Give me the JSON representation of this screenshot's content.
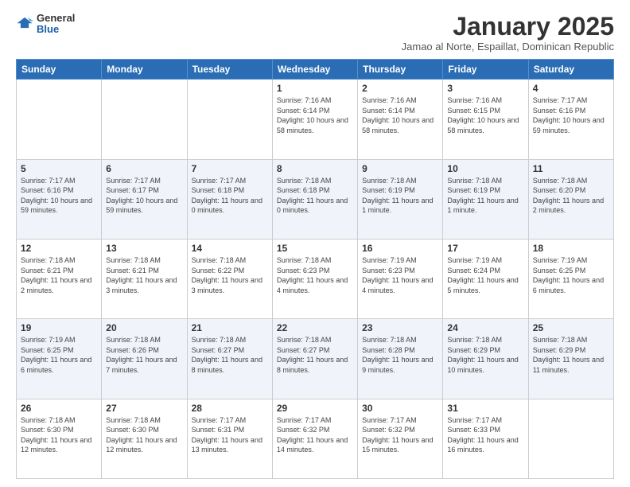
{
  "header": {
    "logo": {
      "general": "General",
      "blue": "Blue"
    },
    "title": "January 2025",
    "subtitle": "Jamao al Norte, Espaillat, Dominican Republic"
  },
  "days_of_week": [
    "Sunday",
    "Monday",
    "Tuesday",
    "Wednesday",
    "Thursday",
    "Friday",
    "Saturday"
  ],
  "weeks": [
    [
      {
        "day": "",
        "info": ""
      },
      {
        "day": "",
        "info": ""
      },
      {
        "day": "",
        "info": ""
      },
      {
        "day": "1",
        "info": "Sunrise: 7:16 AM\nSunset: 6:14 PM\nDaylight: 10 hours and 58 minutes."
      },
      {
        "day": "2",
        "info": "Sunrise: 7:16 AM\nSunset: 6:14 PM\nDaylight: 10 hours and 58 minutes."
      },
      {
        "day": "3",
        "info": "Sunrise: 7:16 AM\nSunset: 6:15 PM\nDaylight: 10 hours and 58 minutes."
      },
      {
        "day": "4",
        "info": "Sunrise: 7:17 AM\nSunset: 6:16 PM\nDaylight: 10 hours and 59 minutes."
      }
    ],
    [
      {
        "day": "5",
        "info": "Sunrise: 7:17 AM\nSunset: 6:16 PM\nDaylight: 10 hours and 59 minutes."
      },
      {
        "day": "6",
        "info": "Sunrise: 7:17 AM\nSunset: 6:17 PM\nDaylight: 10 hours and 59 minutes."
      },
      {
        "day": "7",
        "info": "Sunrise: 7:17 AM\nSunset: 6:18 PM\nDaylight: 11 hours and 0 minutes."
      },
      {
        "day": "8",
        "info": "Sunrise: 7:18 AM\nSunset: 6:18 PM\nDaylight: 11 hours and 0 minutes."
      },
      {
        "day": "9",
        "info": "Sunrise: 7:18 AM\nSunset: 6:19 PM\nDaylight: 11 hours and 1 minute."
      },
      {
        "day": "10",
        "info": "Sunrise: 7:18 AM\nSunset: 6:19 PM\nDaylight: 11 hours and 1 minute."
      },
      {
        "day": "11",
        "info": "Sunrise: 7:18 AM\nSunset: 6:20 PM\nDaylight: 11 hours and 2 minutes."
      }
    ],
    [
      {
        "day": "12",
        "info": "Sunrise: 7:18 AM\nSunset: 6:21 PM\nDaylight: 11 hours and 2 minutes."
      },
      {
        "day": "13",
        "info": "Sunrise: 7:18 AM\nSunset: 6:21 PM\nDaylight: 11 hours and 3 minutes."
      },
      {
        "day": "14",
        "info": "Sunrise: 7:18 AM\nSunset: 6:22 PM\nDaylight: 11 hours and 3 minutes."
      },
      {
        "day": "15",
        "info": "Sunrise: 7:18 AM\nSunset: 6:23 PM\nDaylight: 11 hours and 4 minutes."
      },
      {
        "day": "16",
        "info": "Sunrise: 7:19 AM\nSunset: 6:23 PM\nDaylight: 11 hours and 4 minutes."
      },
      {
        "day": "17",
        "info": "Sunrise: 7:19 AM\nSunset: 6:24 PM\nDaylight: 11 hours and 5 minutes."
      },
      {
        "day": "18",
        "info": "Sunrise: 7:19 AM\nSunset: 6:25 PM\nDaylight: 11 hours and 6 minutes."
      }
    ],
    [
      {
        "day": "19",
        "info": "Sunrise: 7:19 AM\nSunset: 6:25 PM\nDaylight: 11 hours and 6 minutes."
      },
      {
        "day": "20",
        "info": "Sunrise: 7:18 AM\nSunset: 6:26 PM\nDaylight: 11 hours and 7 minutes."
      },
      {
        "day": "21",
        "info": "Sunrise: 7:18 AM\nSunset: 6:27 PM\nDaylight: 11 hours and 8 minutes."
      },
      {
        "day": "22",
        "info": "Sunrise: 7:18 AM\nSunset: 6:27 PM\nDaylight: 11 hours and 8 minutes."
      },
      {
        "day": "23",
        "info": "Sunrise: 7:18 AM\nSunset: 6:28 PM\nDaylight: 11 hours and 9 minutes."
      },
      {
        "day": "24",
        "info": "Sunrise: 7:18 AM\nSunset: 6:29 PM\nDaylight: 11 hours and 10 minutes."
      },
      {
        "day": "25",
        "info": "Sunrise: 7:18 AM\nSunset: 6:29 PM\nDaylight: 11 hours and 11 minutes."
      }
    ],
    [
      {
        "day": "26",
        "info": "Sunrise: 7:18 AM\nSunset: 6:30 PM\nDaylight: 11 hours and 12 minutes."
      },
      {
        "day": "27",
        "info": "Sunrise: 7:18 AM\nSunset: 6:30 PM\nDaylight: 11 hours and 12 minutes."
      },
      {
        "day": "28",
        "info": "Sunrise: 7:17 AM\nSunset: 6:31 PM\nDaylight: 11 hours and 13 minutes."
      },
      {
        "day": "29",
        "info": "Sunrise: 7:17 AM\nSunset: 6:32 PM\nDaylight: 11 hours and 14 minutes."
      },
      {
        "day": "30",
        "info": "Sunrise: 7:17 AM\nSunset: 6:32 PM\nDaylight: 11 hours and 15 minutes."
      },
      {
        "day": "31",
        "info": "Sunrise: 7:17 AM\nSunset: 6:33 PM\nDaylight: 11 hours and 16 minutes."
      },
      {
        "day": "",
        "info": ""
      }
    ]
  ]
}
